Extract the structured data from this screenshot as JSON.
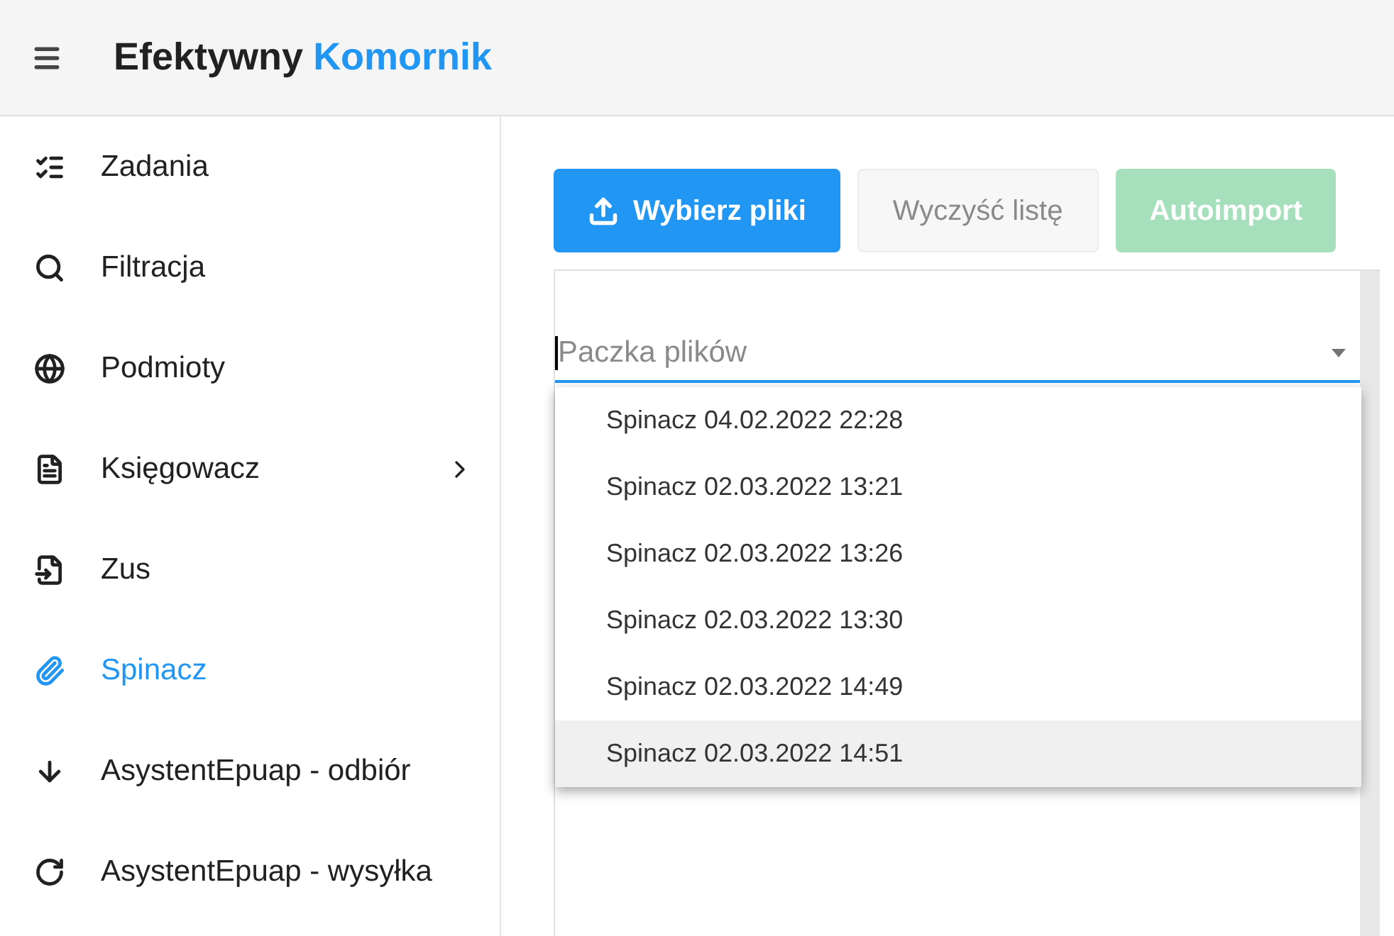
{
  "header": {
    "title": "Efektywny",
    "title_accent": "Komornik"
  },
  "sidebar": {
    "items": [
      {
        "label": "Zadania",
        "selected": false,
        "has_submenu": false
      },
      {
        "label": "Filtracja",
        "selected": false,
        "has_submenu": false
      },
      {
        "label": "Podmioty",
        "selected": false,
        "has_submenu": false
      },
      {
        "label": "Księgowacz",
        "selected": false,
        "has_submenu": true
      },
      {
        "label": "Zus",
        "selected": false,
        "has_submenu": false
      },
      {
        "label": "Spinacz",
        "selected": true,
        "has_submenu": false
      },
      {
        "label": "AsystentEpuap - odbiór",
        "selected": false,
        "has_submenu": false
      },
      {
        "label": "AsystentEpuap - wysyłka",
        "selected": false,
        "has_submenu": false
      }
    ]
  },
  "toolbar": [
    {
      "label": "Wybierz pliki",
      "kind": "primary",
      "disabled": false
    },
    {
      "label": "Wyczyść listę",
      "kind": "plain",
      "disabled": true
    },
    {
      "label": "Autoimport",
      "kind": "success",
      "disabled": true
    }
  ],
  "package_select": {
    "placeholder": "Paczka plików",
    "expanded": true,
    "options": [
      {
        "label": "Spinacz 04.02.2022 22:28",
        "selected": false
      },
      {
        "label": "Spinacz 02.03.2022 13:21",
        "selected": false
      },
      {
        "label": "Spinacz 02.03.2022 13:26",
        "selected": false
      },
      {
        "label": "Spinacz 02.03.2022 13:30",
        "selected": false
      },
      {
        "label": "Spinacz 02.03.2022 14:49",
        "selected": false
      },
      {
        "label": "Spinacz 02.03.2022 14:51",
        "selected": true
      }
    ]
  }
}
